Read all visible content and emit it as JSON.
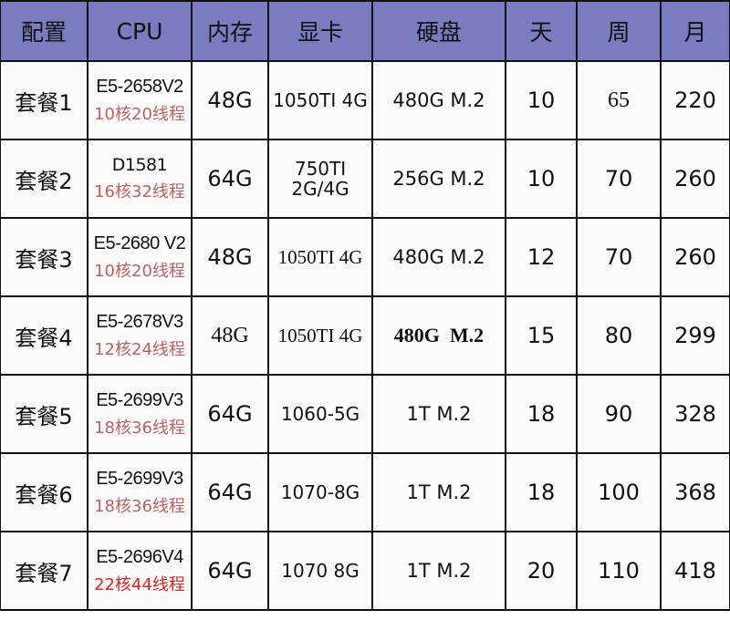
{
  "header": {
    "columns": [
      "配置",
      "CPU",
      "内存",
      "显卡",
      "硬盘",
      "天",
      "周",
      "月"
    ],
    "background_color": "#7b7bc0"
  },
  "rows": [
    {
      "name": "套餐1",
      "cpu_model": "E5-2658V2",
      "cpu_threads": "10核20线程",
      "memory": "48G",
      "gpu": "1050TI 4G",
      "disk": "480G M.2",
      "day": "10",
      "week": "65",
      "month": "220"
    },
    {
      "name": "套餐2",
      "cpu_model": "D1581",
      "cpu_threads": "16核32线程",
      "memory": "64G",
      "gpu": "750TI 2G/4G",
      "disk": "256G M.2",
      "day": "10",
      "week": "70",
      "month": "260"
    },
    {
      "name": "套餐3",
      "cpu_model": "E5-2680 V2",
      "cpu_threads": "10核20线程",
      "memory": "48G",
      "gpu": "1050TI 4G",
      "disk": "480G M.2",
      "day": "12",
      "week": "70",
      "month": "260"
    },
    {
      "name": "套餐4",
      "cpu_model": "E5-2678V3",
      "cpu_threads": "12核24线程",
      "memory": "48G",
      "gpu": "1050TI 4G",
      "disk": "480G  M.2",
      "day": "15",
      "week": "80",
      "month": "299"
    },
    {
      "name": "套餐5",
      "cpu_model": "E5-2699V3",
      "cpu_threads": "18核36线程",
      "memory": "64G",
      "gpu": "1060-5G",
      "disk": "1T M.2",
      "day": "18",
      "week": "90",
      "month": "328"
    },
    {
      "name": "套餐6",
      "cpu_model": "E5-2699V3",
      "cpu_threads": "18核36线程",
      "memory": "64G",
      "gpu": "1070-8G",
      "disk": "1T M.2",
      "day": "18",
      "week": "100",
      "month": "368"
    },
    {
      "name": "套餐7",
      "cpu_model": "E5-2696V4",
      "cpu_threads": "22核44线程",
      "memory": "64G",
      "gpu": "1070 8G",
      "disk": "1T M.2",
      "day": "20",
      "week": "110",
      "month": "418"
    }
  ],
  "colors": {
    "threads_text": "#c06060",
    "threads_highlight": "#e02020"
  }
}
